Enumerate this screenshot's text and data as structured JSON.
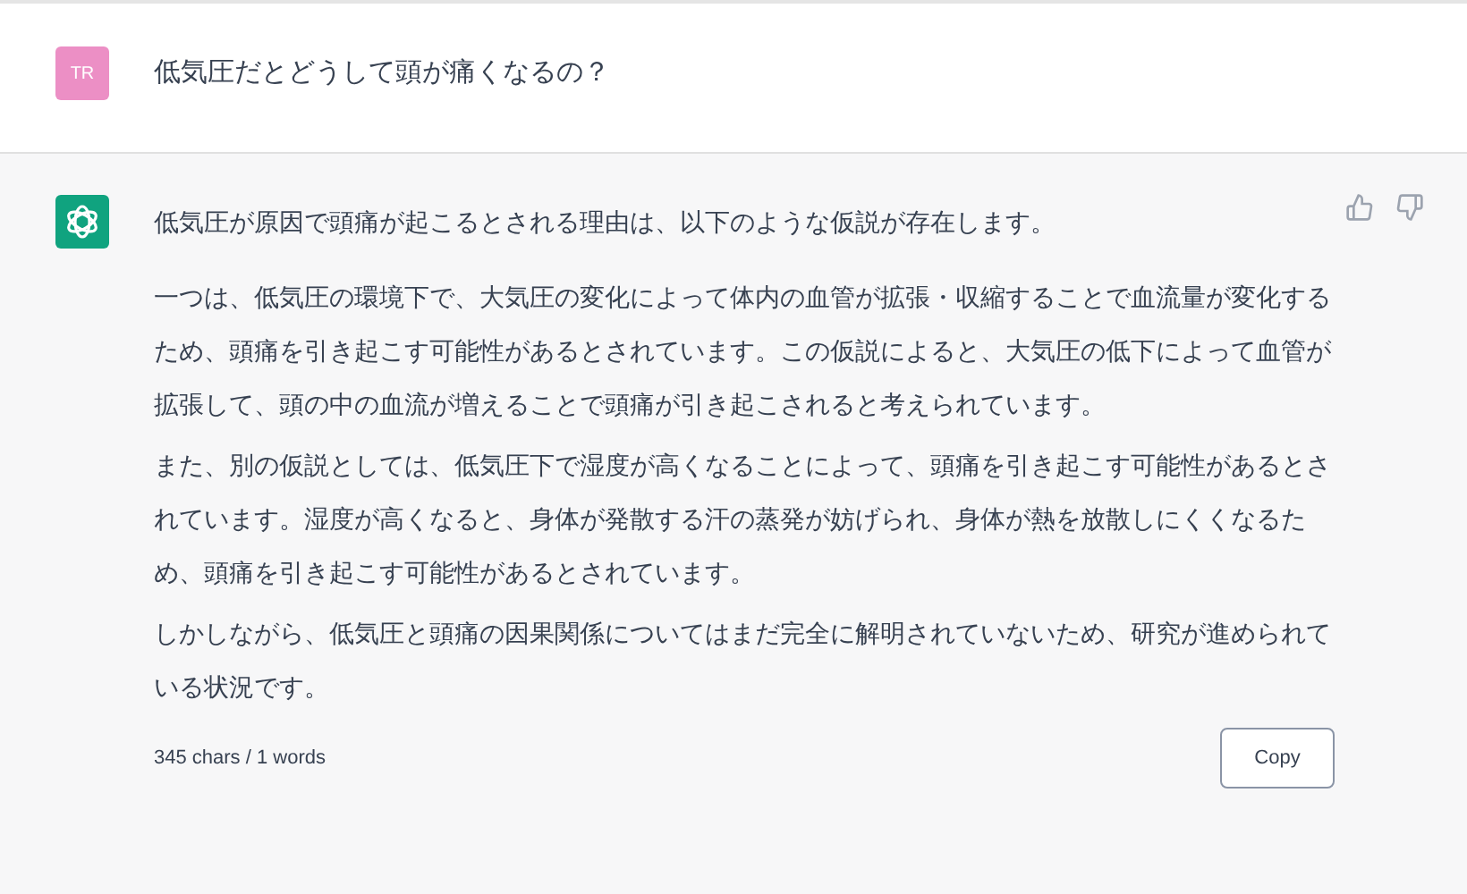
{
  "user_message": {
    "avatar": "TR",
    "text": "低気圧だとどうして頭が痛くなるの？"
  },
  "assistant_message": {
    "paragraphs": [
      "低気圧が原因で頭痛が起こるとされる理由は、以下のような仮説が存在します。",
      "一つは、低気圧の環境下で、大気圧の変化によって体内の血管が拡張・収縮することで血流量が変化するため、頭痛を引き起こす可能性があるとされています。この仮説によると、大気圧の低下によって血管が拡張して、頭の中の血流が増えることで頭痛が引き起こされると考えられています。",
      "また、別の仮説としては、低気圧下で湿度が高くなることによって、頭痛を引き起こす可能性があるとされています。湿度が高くなると、身体が発散する汗の蒸発が妨げられ、身体が熱を放散しにくくなるため、頭痛を引き起こす可能性があるとされています。",
      "しかしながら、低気圧と頭痛の因果関係についてはまだ完全に解明されていないため、研究が進められている状況です。"
    ],
    "counter": "345 chars / 1 words",
    "copy_button": "Copy"
  }
}
